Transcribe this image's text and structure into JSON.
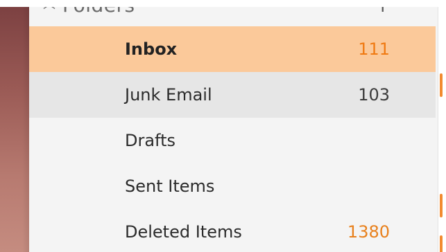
{
  "sidebar": {
    "header": {
      "title": "Folders",
      "chevron_icon": "chevron-up-icon",
      "add_icon": "plus-icon"
    },
    "folders": [
      {
        "label": "Inbox",
        "count": "111",
        "state": "selected",
        "count_color": "#f07a12"
      },
      {
        "label": "Junk Email",
        "count": "103",
        "state": "hover",
        "count_color": "#3b3b3b"
      },
      {
        "label": "Drafts",
        "count": "",
        "state": "normal"
      },
      {
        "label": "Sent Items",
        "count": "",
        "state": "normal"
      },
      {
        "label": "Deleted Items",
        "count": "1380",
        "state": "normal",
        "count_color": "#e8801c"
      }
    ]
  },
  "colors": {
    "selected_row": "#fbc99a",
    "hover_row": "#e6e6e6",
    "accent": "#f28b2f",
    "panel_bg": "#f4f4f4"
  }
}
